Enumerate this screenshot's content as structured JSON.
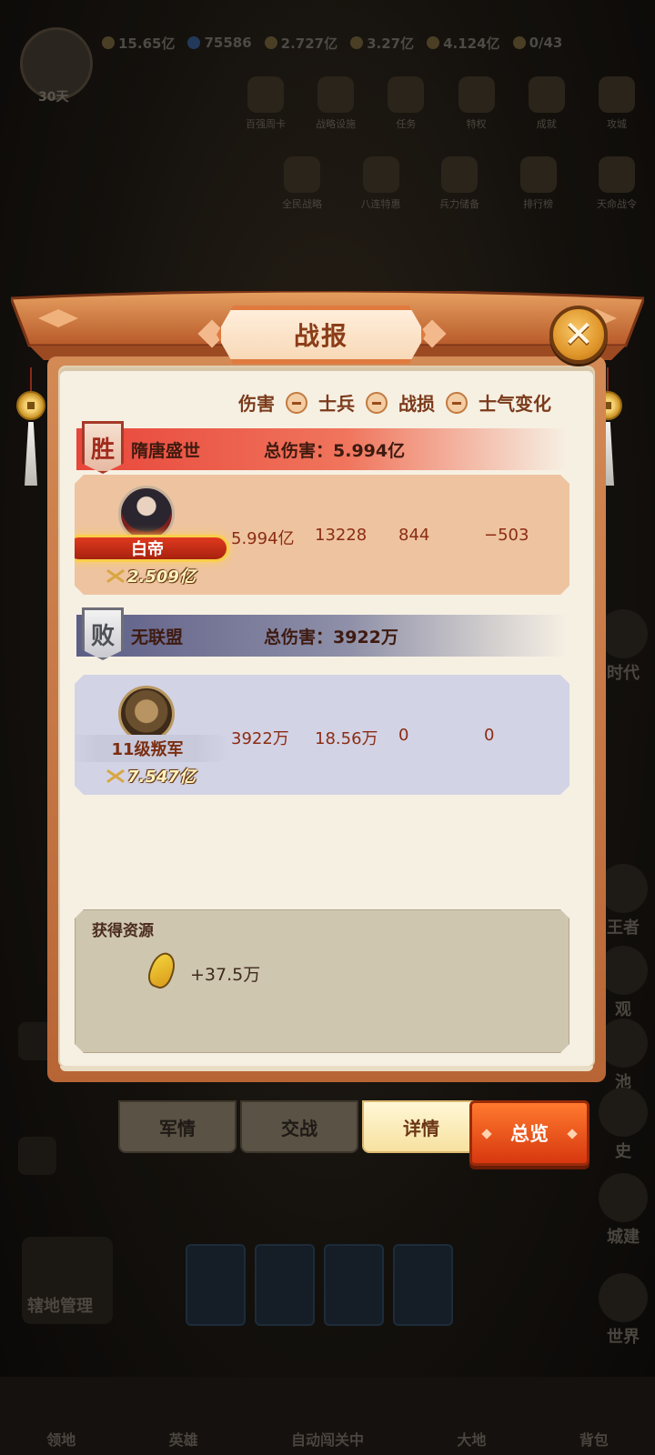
{
  "hud": {
    "days": "30天",
    "resources": [
      "15.65亿",
      "75586",
      "2.727亿",
      "3.27亿",
      "4.124亿",
      "0/43"
    ],
    "top_row": [
      "百强周卡",
      "战略设施",
      "任务",
      "特权",
      "成就",
      "攻城"
    ],
    "second_row": [
      "全民战略",
      "八连特惠",
      "兵力储备",
      "排行榜",
      "天命战令"
    ],
    "right_side": [
      "时代",
      "王者",
      "观",
      "池",
      "史",
      "城建",
      "世界"
    ],
    "land_button": "辖地管理",
    "bottom_nav": [
      "领地",
      "英雄",
      "自动闯关中",
      "大地",
      "背包"
    ]
  },
  "dialog": {
    "title": "战报",
    "legend": {
      "damage": "伤害",
      "soldiers": "士兵",
      "losses": "战损",
      "morale": "士气变化"
    },
    "winner": {
      "badge": "胜",
      "alliance": "隋唐盛世",
      "total_damage": "总伤害：5.994亿",
      "hero_name": "白帝",
      "power": "2.509亿",
      "damage": "5.994亿",
      "soldiers": "13228",
      "losses": "844",
      "morale": "−503"
    },
    "loser": {
      "badge": "败",
      "alliance": "无联盟",
      "total_damage": "总伤害：3922万",
      "hero_name": "11级叛军",
      "power": "7.547亿",
      "damage": "3922万",
      "soldiers": "18.56万",
      "losses": "0",
      "morale": "0"
    },
    "resources": {
      "title": "获得资源",
      "grain_amount": "+37.5万"
    },
    "tabs": [
      "军情",
      "交战",
      "详情"
    ],
    "active_tab": "详情",
    "overview_button": "总览"
  },
  "colors": {
    "frame": "#c56f3c",
    "win_header": "#e8463a",
    "lose_header": "#5d5e86",
    "overview": "#e8501c"
  }
}
